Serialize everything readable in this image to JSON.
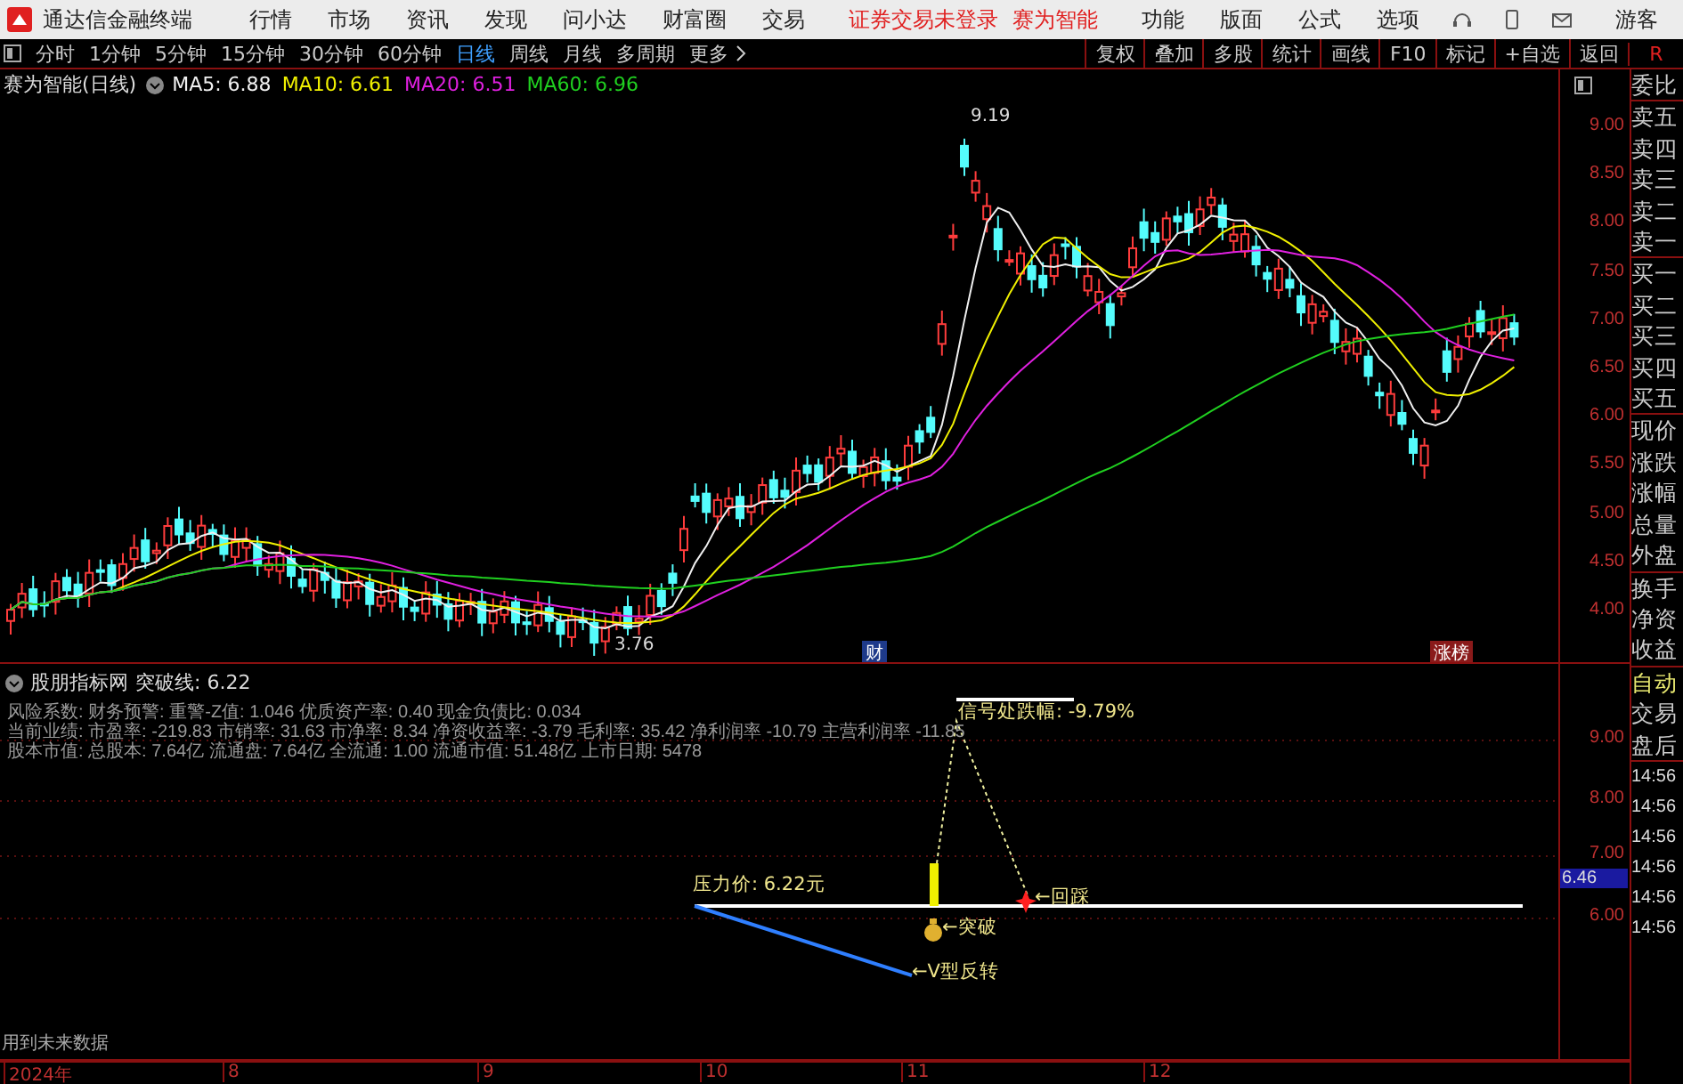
{
  "app": {
    "title": "通达信金融终端",
    "menu": [
      "行情",
      "市场",
      "资讯",
      "发现",
      "问小达",
      "财富圈",
      "交易"
    ],
    "notices": [
      "证券交易未登录",
      "赛为智能"
    ],
    "right_menu": [
      "功能",
      "版面",
      "公式",
      "选项"
    ],
    "user": "游客"
  },
  "period_tabs": [
    {
      "label": "分时",
      "selected": false
    },
    {
      "label": "1分钟",
      "selected": false
    },
    {
      "label": "5分钟",
      "selected": false
    },
    {
      "label": "15分钟",
      "selected": false
    },
    {
      "label": "30分钟",
      "selected": false
    },
    {
      "label": "60分钟",
      "selected": false
    },
    {
      "label": "日线",
      "selected": true
    },
    {
      "label": "周线",
      "selected": false
    },
    {
      "label": "月线",
      "selected": false
    },
    {
      "label": "多周期",
      "selected": false
    },
    {
      "label": "更多",
      "selected": false
    }
  ],
  "tools": [
    "复权",
    "叠加",
    "多股",
    "统计",
    "画线",
    "F10",
    "标记",
    "+自选",
    "返回"
  ],
  "corner_label": "R",
  "main_chart": {
    "title": "赛为智能(日线)",
    "ma": [
      {
        "label": "MA5: 6.88",
        "color": "#f0f0f0"
      },
      {
        "label": "MA10: 6.61",
        "color": "#f0f000"
      },
      {
        "label": "MA20: 6.51",
        "color": "#e020e0"
      },
      {
        "label": "MA60: 6.96",
        "color": "#20d020"
      }
    ],
    "yticks": [
      "9.00",
      "8.50",
      "8.00",
      "7.50",
      "7.00",
      "6.50",
      "6.00",
      "5.50",
      "5.00",
      "4.50",
      "4.00"
    ],
    "high_label": "9.19",
    "low_label": "3.76",
    "markers": [
      {
        "label": "财",
        "kind": "news"
      },
      {
        "label": "涨榜",
        "kind": "rank"
      }
    ]
  },
  "indicator": {
    "name": "股朋指标网",
    "value": "突破线: 6.22",
    "info_lines": [
      "风险系数: 财务预警: 重警-Z值: 1.046 优质资产率: 0.40 现金负债比: 0.034",
      "当前业绩: 市盈率: -219.83 市销率: 31.63 市净率: 8.34 净资收益率: -3.79 毛利率: 35.42 净利润率 -10.79 主营利润率 -11.85",
      "股本市值: 总股本: 7.64亿 流通盘: 7.64亿 全流通: 1.00 流通市值: 51.48亿 上市日期: 5478"
    ],
    "signal_label": "信号处跌幅: -9.79%",
    "pressure_label": "压力价: 6.22元",
    "breakout_label": "←突破",
    "pullback_label": "←回踩",
    "reversal_label": "←V型反转",
    "yticks": [
      "9.00",
      "8.00",
      "7.00",
      "6.00"
    ],
    "current_tag": "6.46",
    "note": "用到未来数据"
  },
  "date_axis": [
    "2024年",
    "8",
    "9",
    "10",
    "11",
    "12"
  ],
  "quote_panel": {
    "groups": [
      [
        "委比"
      ],
      [
        "卖五",
        "卖四",
        "卖三",
        "卖二",
        "卖一"
      ],
      [
        "买一",
        "买二",
        "买三",
        "买四",
        "买五"
      ],
      [
        "现价",
        "涨跌",
        "涨幅",
        "总量",
        "外盘"
      ],
      [
        "换手",
        "净资",
        "收益"
      ]
    ],
    "modes": [
      {
        "label": "自动",
        "selected": true
      },
      {
        "label": "交易",
        "selected": false
      },
      {
        "label": "盘后",
        "selected": false
      }
    ],
    "times": [
      "14:56",
      "14:56",
      "14:56",
      "14:56",
      "14:56",
      "14:56"
    ]
  }
}
